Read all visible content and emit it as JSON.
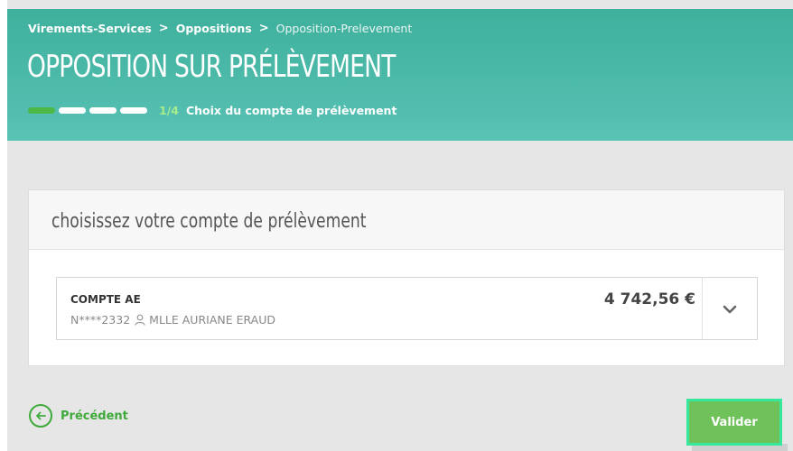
{
  "breadcrumb": {
    "items": [
      "Virements-Services",
      "Oppositions",
      "Opposition-Prelevement"
    ],
    "separator": ">"
  },
  "header": {
    "title": "OPPOSITION SUR PRÉLÈVEMENT",
    "progress": {
      "current": 1,
      "total": 4,
      "step_text": "1/4",
      "step_label": "Choix du compte de prélèvement"
    }
  },
  "card": {
    "title": "choisissez votre compte de prélèvement",
    "account": {
      "name": "COMPTE AE",
      "number": "N****2332",
      "holder": "MLLE AURIANE ERAUD",
      "balance": "4 742,56 €"
    }
  },
  "footer": {
    "back_label": "Précédent",
    "validate_label": "Valider"
  },
  "colors": {
    "header_teal": "#3eb09c",
    "accent_green": "#4cb848",
    "button_green": "#6fc15a",
    "focus_outline": "#35e89c"
  }
}
